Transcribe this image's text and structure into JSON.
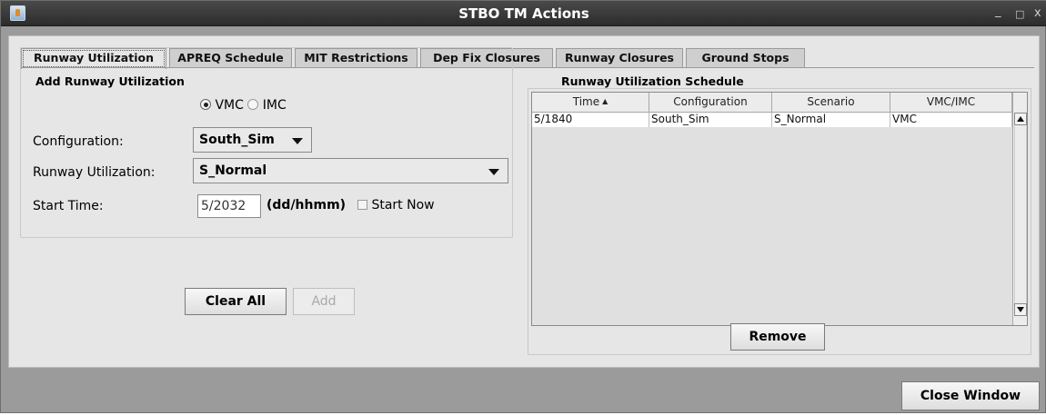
{
  "window": {
    "title": "STBO TM Actions",
    "minimize_glyph": "_",
    "maximize_glyph": "□",
    "close_glyph": "x",
    "app_icon": "java-cup-icon"
  },
  "tabs": [
    {
      "label": "Runway Utilization",
      "active": true
    },
    {
      "label": "APREQ Schedule",
      "active": false
    },
    {
      "label": "MIT Restrictions",
      "active": false
    },
    {
      "label": "Dep Fix Closures",
      "active": false
    },
    {
      "label": "Runway Closures",
      "active": false
    },
    {
      "label": "Ground Stops",
      "active": false
    }
  ],
  "add_section": {
    "title": "Add Runway Utilization",
    "vmc_label": "VMC",
    "imc_label": "IMC",
    "selected_condition": "VMC",
    "configuration_label": "Configuration:",
    "configuration_value": "South_Sim",
    "runway_util_label": "Runway Utilization:",
    "runway_util_value": "S_Normal",
    "start_time_label": "Start Time:",
    "start_time_value": "5/2032",
    "start_time_format": "(dd/hhmm)",
    "start_now_label": "Start Now",
    "start_now_checked": false,
    "clear_all_label": "Clear All",
    "add_label": "Add"
  },
  "schedule": {
    "title": "Runway Utilization Schedule",
    "columns": [
      "Time",
      "Configuration",
      "Scenario",
      "VMC/IMC"
    ],
    "sort_column": "Time",
    "sort_direction": "ascending",
    "rows": [
      [
        "5/1840",
        "South_Sim",
        "S_Normal",
        "VMC"
      ]
    ],
    "remove_label": "Remove"
  },
  "footer": {
    "close_label": "Close Window"
  }
}
